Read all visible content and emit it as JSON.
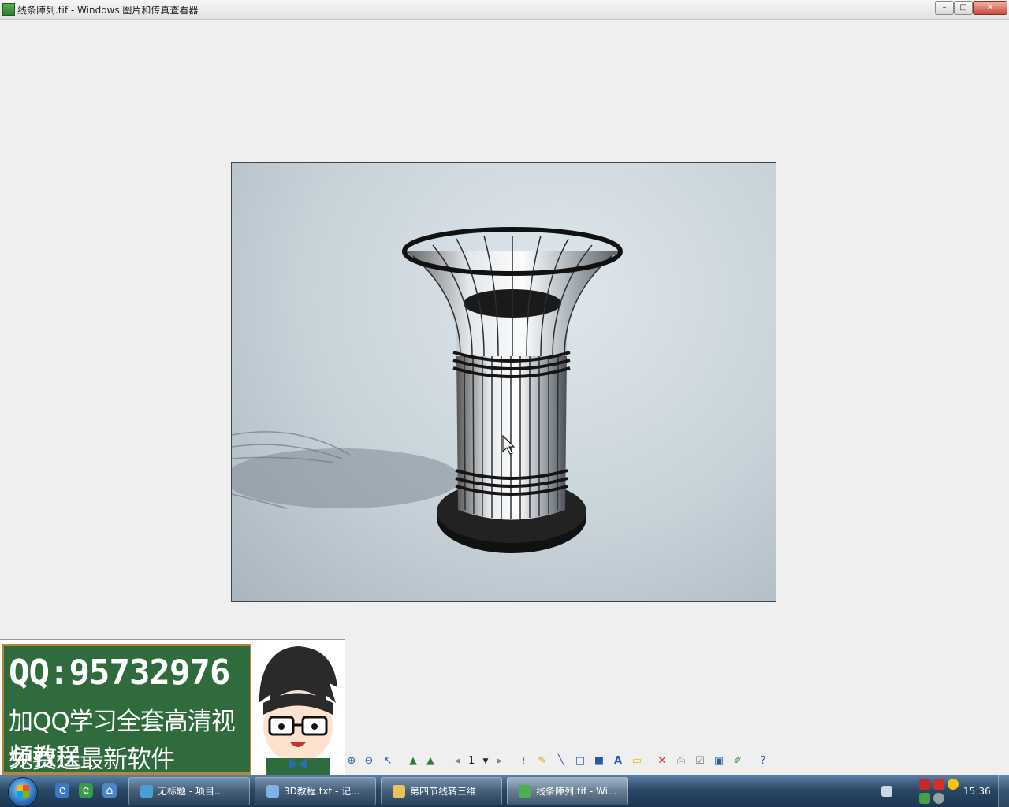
{
  "window": {
    "title": "线条陣列.tif - Windows 图片和传真查看器",
    "btn_min": "–",
    "btn_max": "□",
    "btn_close": "✕"
  },
  "ad": {
    "qq": "QQ:95732976",
    "line1": "加QQ学习全套高清视频教程",
    "line2": "免费送最新软件"
  },
  "toolbar": {
    "page_number": "1",
    "icons": [
      "zoom-in-icon",
      "zoom-out-icon",
      "pointer-icon",
      "rotate-left-icon",
      "rotate-right-icon",
      "prev-page-icon",
      "next-page-icon",
      "curve-icon",
      "highlighter-icon",
      "line-icon",
      "rectangle-icon",
      "filled-rectangle-icon",
      "text-icon",
      "note-icon",
      "delete-icon",
      "print-icon",
      "copy-icon",
      "save-icon",
      "edit-icon",
      "help-icon"
    ]
  },
  "taskbar": {
    "items": [
      {
        "label": "无标题        - 项目...",
        "color": "#4aa0d6"
      },
      {
        "label": "3D教程.txt - 记...",
        "color": "#7fb3e6"
      },
      {
        "label": "第四节线转三维",
        "color": "#e8c25a"
      },
      {
        "label": "线条陣列.tif - Wi...",
        "color": "#4caf50"
      }
    ],
    "clock": "15:36"
  },
  "colors": {
    "accent": "#2f6b3c",
    "frame": "#b8863b"
  }
}
